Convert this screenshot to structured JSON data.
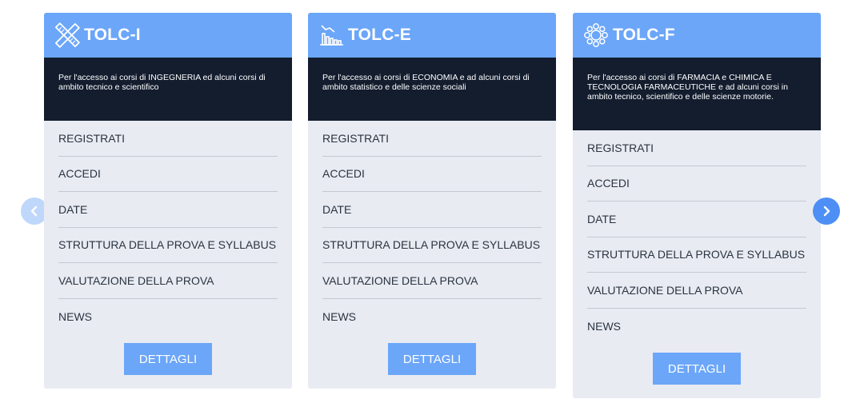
{
  "cards": [
    {
      "title": "TOLC-I",
      "icon": "ruler-pencil-icon",
      "description": "Per l'accesso ai corsi di INGEGNERIA ed alcuni corsi di ambito tecnico e scientifico",
      "menu": [
        "REGISTRATI",
        "ACCEDI",
        "DATE",
        "STRUTTURA DELLA PROVA E SYLLABUS",
        "VALUTAZIONE DELLA PROVA",
        "NEWS"
      ],
      "button": "DETTAGLI"
    },
    {
      "title": "TOLC-E",
      "icon": "bar-chart-icon",
      "description": "Per l'accesso ai corsi di ECONOMIA e ad alcuni corsi di ambito statistico e delle scienze sociali",
      "menu": [
        "REGISTRATI",
        "ACCEDI",
        "DATE",
        "STRUTTURA DELLA PROVA E SYLLABUS",
        "VALUTAZIONE DELLA PROVA",
        "NEWS"
      ],
      "button": "DETTAGLI"
    },
    {
      "title": "TOLC-F",
      "icon": "molecule-icon",
      "description": "Per l'accesso ai corsi di FARMACIA e CHIMICA E TECNOLOGIA FARMACEUTICHE e ad alcuni corsi in ambito tecnico, scientifico e delle scienze motorie.",
      "menu": [
        "REGISTRATI",
        "ACCEDI",
        "DATE",
        "STRUTTURA DELLA PROVA E SYLLABUS",
        "VALUTAZIONE DELLA PROVA",
        "NEWS"
      ],
      "button": "DETTAGLI"
    }
  ],
  "navigation": {
    "prev_icon": "chevron-left-icon",
    "next_icon": "chevron-right-icon"
  },
  "colors": {
    "header": "#6ba6f9",
    "description_bg": "#131d2e",
    "card_bg": "#e8ebf2",
    "nav_prev": "#bfd7fb",
    "nav_next": "#4d8ff5"
  }
}
